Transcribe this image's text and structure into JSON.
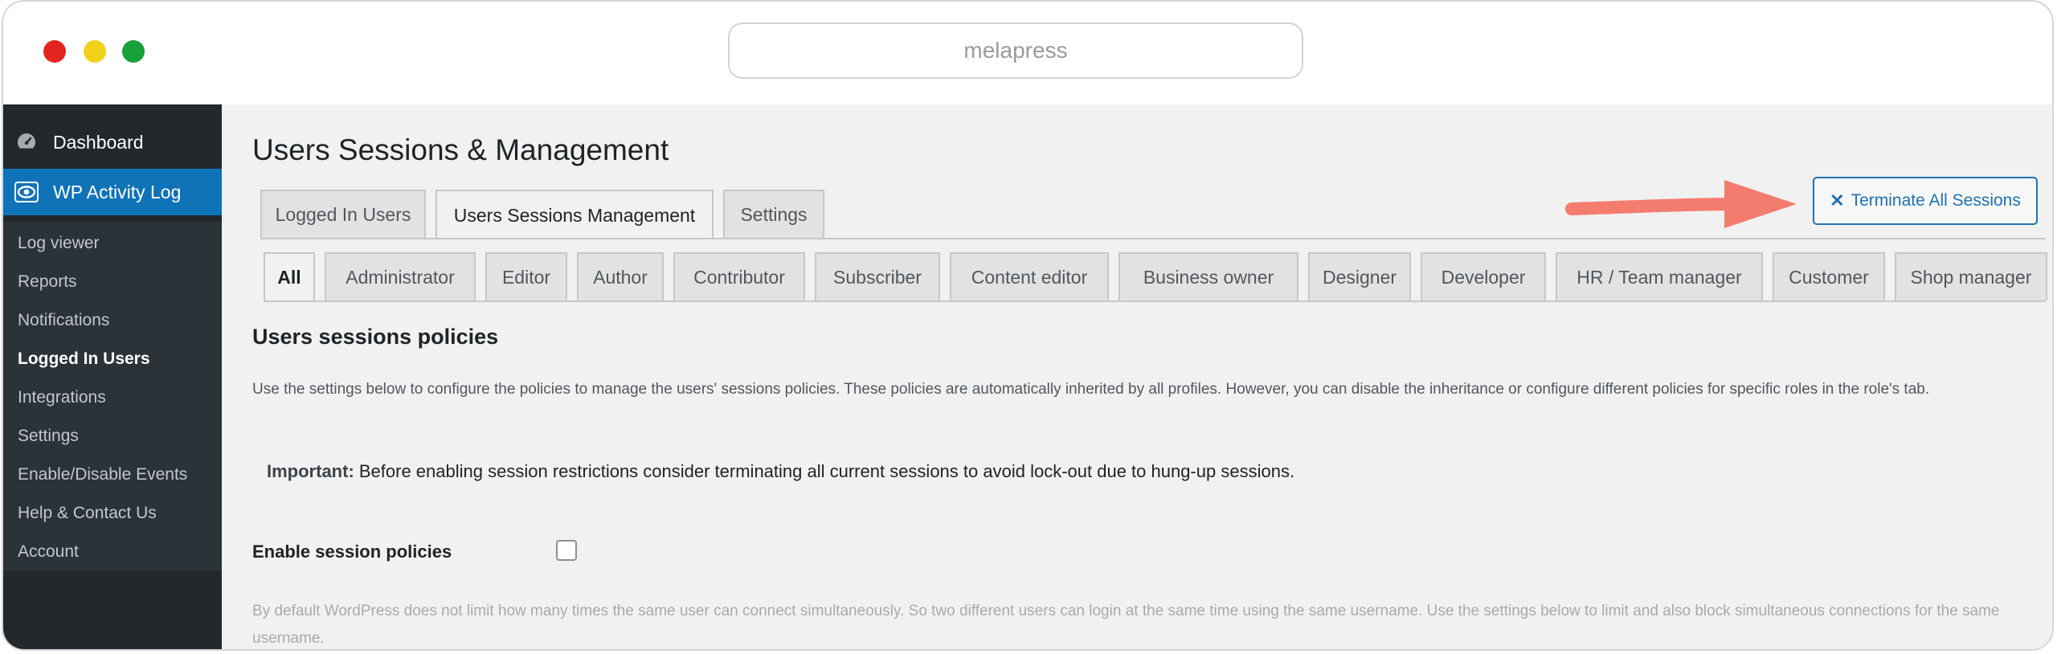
{
  "browser": {
    "url": "melapress"
  },
  "sidebar": {
    "dashboard": "Dashboard",
    "plugin": "WP Activity Log",
    "submenu": [
      "Log viewer",
      "Reports",
      "Notifications",
      "Logged In Users",
      "Integrations",
      "Settings",
      "Enable/Disable Events",
      "Help & Contact Us",
      "Account"
    ]
  },
  "page": {
    "title": "Users Sessions & Management",
    "tabs": [
      "Logged In Users",
      "Users Sessions Management",
      "Settings"
    ],
    "terminate_label": "Terminate All Sessions",
    "roles": [
      "All",
      "Administrator",
      "Editor",
      "Author",
      "Contributor",
      "Subscriber",
      "Content editor",
      "Business owner",
      "Designer",
      "Developer",
      "HR / Team manager",
      "Customer",
      "Shop manager"
    ],
    "section_title": "Users sessions policies",
    "description": "Use the settings below to configure the policies to manage the users' sessions policies. These policies are automatically inherited by all profiles. However, you can disable the inheritance or configure different policies for specific roles in the role's tab.",
    "important_label": "Important:",
    "important_text": " Before enabling session restrictions consider terminating all current sessions to avoid lock-out due to hung-up sessions.",
    "enable_label": "Enable session policies",
    "default_desc": "By default WordPress does not limit how many times the same user can connect simultaneously. So two different users can login at the same time using the same username. Use the settings below to limit and also block simultaneous connections for the same username."
  },
  "colors": {
    "sidebar_bg": "#23282d",
    "accent": "#2271b1",
    "highlight": "#0f73b8",
    "arrow": "#f47c6e"
  }
}
